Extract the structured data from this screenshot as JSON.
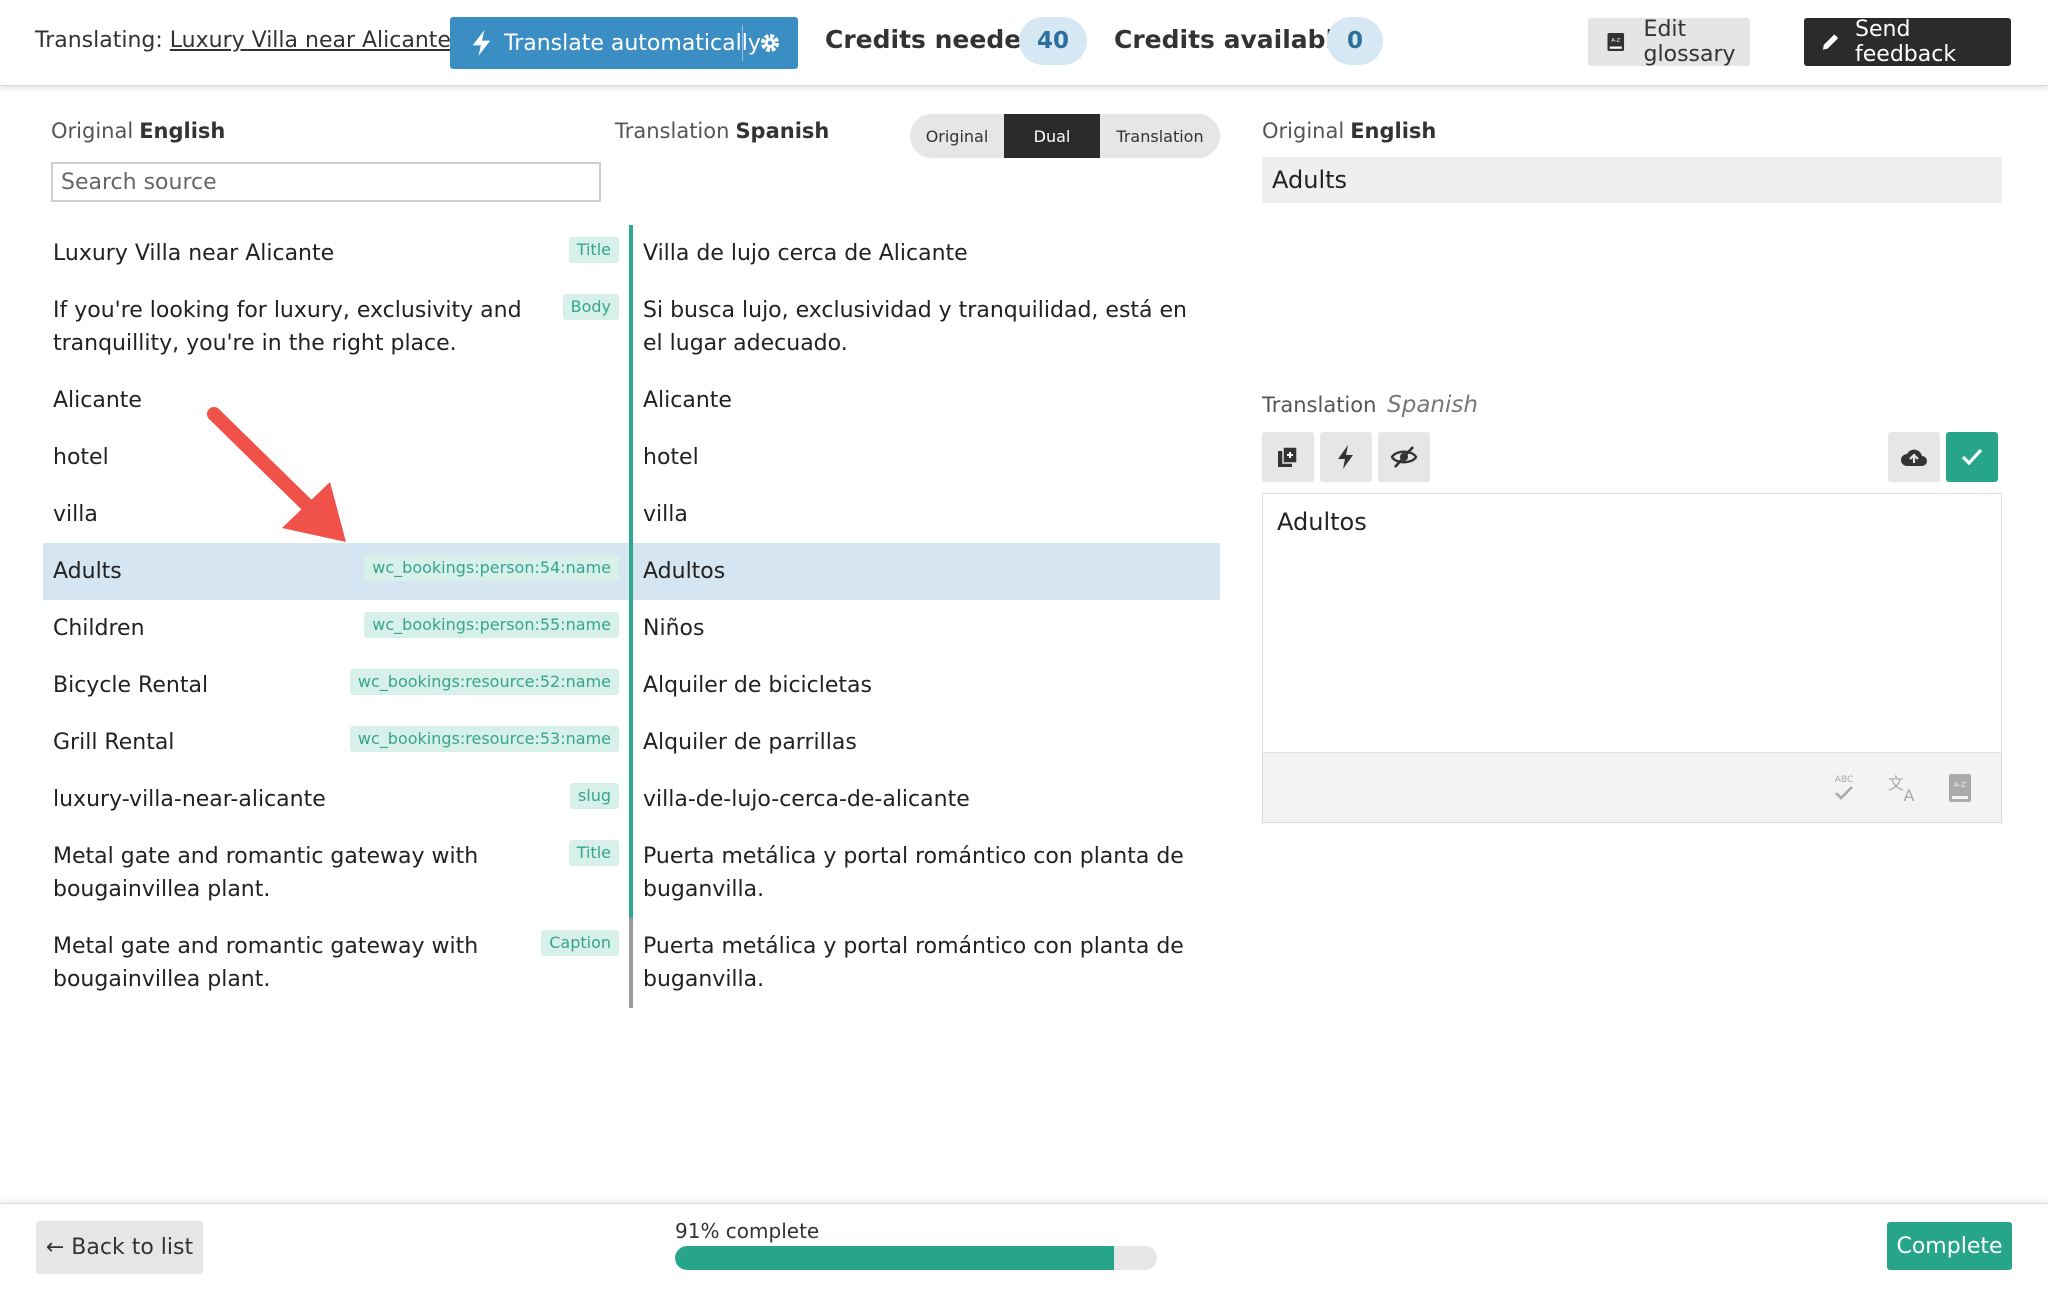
{
  "header": {
    "translating_label": "Translating:",
    "document_title": "Luxury Villa near Alicante",
    "translate_button": "Translate automatically",
    "credits_needed_label": "Credits needed",
    "credits_needed_value": "40",
    "credits_available_label": "Credits available",
    "credits_available_value": "0",
    "glossary_button": "Edit glossary",
    "feedback_button": "Send feedback"
  },
  "left": {
    "original_label": "Original",
    "original_lang": "English",
    "translation_label": "Translation",
    "translation_lang": "Spanish",
    "search_placeholder": "Search source",
    "view_options": [
      "Original",
      "Dual",
      "Translation"
    ],
    "view_active": "Dual"
  },
  "rows": [
    {
      "source": "Luxury Villa near Alicante",
      "tag": "Title",
      "target": "Villa de lujo cerca de Alicante"
    },
    {
      "source": "If you're looking for luxury, exclusivity and tranquillity, you're in the right place.",
      "tag": "Body",
      "target": "Si busca lujo, exclusividad y tranquilidad, está en el lugar adecuado."
    },
    {
      "source": "Alicante",
      "tag": "",
      "target": "Alicante"
    },
    {
      "source": "hotel",
      "tag": "",
      "target": "hotel"
    },
    {
      "source": "villa",
      "tag": "",
      "target": "villa"
    },
    {
      "source": "Adults",
      "tag": "wc_bookings:person:54:name",
      "target": "Adultos",
      "selected": true
    },
    {
      "source": "Children",
      "tag": "wc_bookings:person:55:name",
      "target": "Niños"
    },
    {
      "source": "Bicycle Rental",
      "tag": "wc_bookings:resource:52:name",
      "target": "Alquiler de bicicletas"
    },
    {
      "source": "Grill Rental",
      "tag": "wc_bookings:resource:53:name",
      "target": "Alquiler de parrillas"
    },
    {
      "source": "luxury-villa-near-alicante",
      "tag": "slug",
      "target": "villa-de-lujo-cerca-de-alicante"
    },
    {
      "source": "Metal gate and romantic gateway with bougainvillea plant.",
      "tag": "Title",
      "target": "Puerta metálica y portal romántico con planta de buganvilla."
    },
    {
      "source": "Metal gate and romantic gateway with bougainvillea plant.",
      "tag": "Caption",
      "target": "Puerta metálica y portal romántico con planta de buganvilla.",
      "grey": true
    }
  ],
  "right": {
    "original_label": "Original",
    "original_lang": "English",
    "original_text": "Adults",
    "translation_label": "Translation",
    "translation_lang": "Spanish",
    "translation_text": "Adultos"
  },
  "footer": {
    "back_button": "← Back to list",
    "progress_label": "91% complete",
    "progress_fraction": 0.91,
    "complete_button": "Complete"
  },
  "colors": {
    "accent_blue": "#3b8ec4",
    "accent_green": "#27a58b",
    "selected_row": "#d5e5f1",
    "arrow": "#f0524a"
  }
}
